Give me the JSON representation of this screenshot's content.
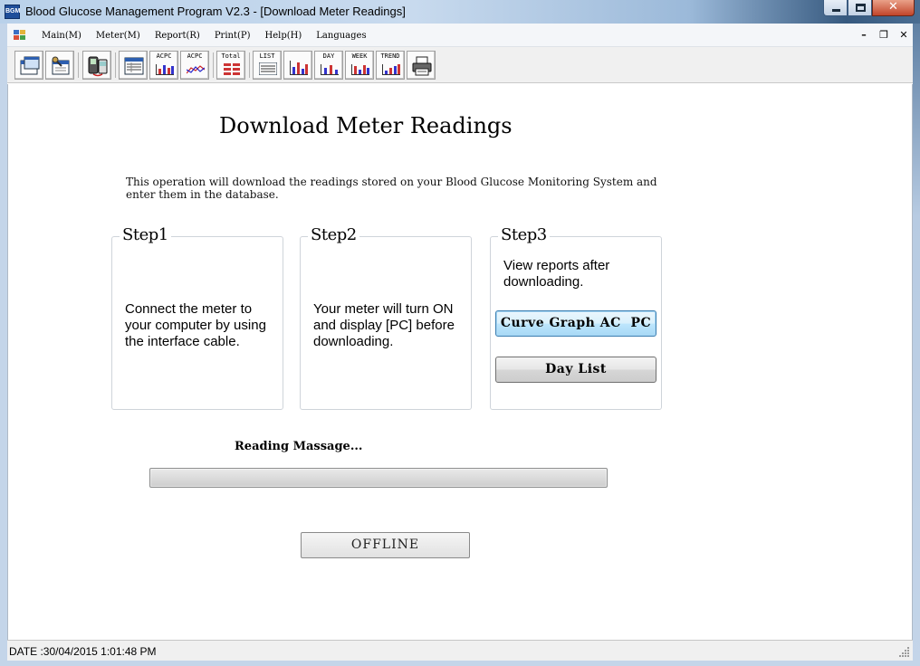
{
  "window": {
    "icon_text": "BGM",
    "title": "Blood Glucose Management Program V2.3 - [Download Meter Readings]"
  },
  "menu": {
    "items": [
      "Main(M)",
      "Meter(M)",
      "Report(R)",
      "Print(P)",
      "Help(H)",
      "Languages"
    ]
  },
  "toolbar": {
    "buttons": [
      {
        "name": "main-window-icon",
        "label": ""
      },
      {
        "name": "settings-icon",
        "label": ""
      },
      {
        "name": "meter-download-icon",
        "label": ""
      },
      {
        "name": "table-report-icon",
        "label": ""
      },
      {
        "name": "acpc-report-icon",
        "label": "ACPC"
      },
      {
        "name": "acpc-graph-icon",
        "label": "ACPC"
      },
      {
        "name": "total-report-icon",
        "label": "Total"
      },
      {
        "name": "list-report-icon",
        "label": "LIST"
      },
      {
        "name": "bar-chart-icon",
        "label": ""
      },
      {
        "name": "day-report-icon",
        "label": "DAY"
      },
      {
        "name": "week-report-icon",
        "label": "WEEK"
      },
      {
        "name": "trend-report-icon",
        "label": "TREND"
      },
      {
        "name": "printer-icon",
        "label": ""
      }
    ]
  },
  "page": {
    "title": "Download Meter Readings",
    "intro": "This operation will download the readings stored on your Blood Glucose Monitoring System and enter them in the database."
  },
  "steps": [
    {
      "title": "Step1",
      "text": "Connect the meter to your computer by using the interface cable."
    },
    {
      "title": "Step2",
      "text": "Your meter will turn ON and display [PC] before downloading."
    },
    {
      "title": "Step3",
      "text": "View reports after downloading.",
      "buttons": [
        "Curve Graph AC  PC",
        "Day List"
      ]
    }
  ],
  "reading": {
    "label": "Reading Massage...",
    "progress_percent": 0
  },
  "offline_button": "OFFLINE",
  "status": {
    "text": "DATE :30/04/2015 1:01:48 PM"
  },
  "colors": {
    "titlebar_accent": "#36597f",
    "close_button": "#c2452a",
    "progress_fill": "#2ea83a",
    "focused_button": "#3c7fb1"
  }
}
